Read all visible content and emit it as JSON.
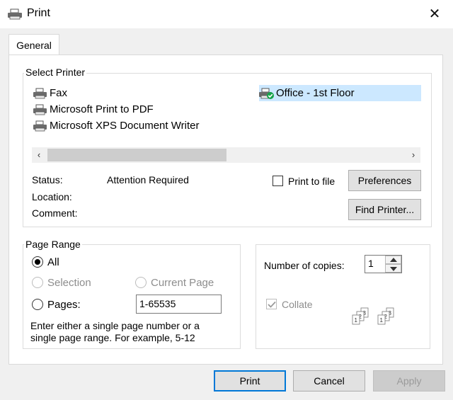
{
  "window": {
    "title": "Print",
    "close_glyph": "✕"
  },
  "tabs": [
    {
      "label": "General"
    }
  ],
  "select_printer": {
    "title": "Select Printer",
    "printers": [
      {
        "name": "Fax"
      },
      {
        "name": "Microsoft Print to PDF"
      },
      {
        "name": "Microsoft XPS Document Writer"
      },
      {
        "name": "Office - 1st Floor",
        "selected": true,
        "default": true
      }
    ],
    "scroll_left": "‹",
    "scroll_right": "›",
    "status_label": "Status:",
    "status_value": "Attention Required",
    "location_label": "Location:",
    "location_value": "",
    "comment_label": "Comment:",
    "comment_value": "",
    "print_to_file_label": "Print to file",
    "print_to_file_checked": false,
    "preferences_label": "Preferences",
    "find_printer_label": "Find Printer..."
  },
  "page_range": {
    "title": "Page Range",
    "all_label": "All",
    "selection_label": "Selection",
    "current_page_label": "Current Page",
    "pages_label": "Pages:",
    "pages_value": "1-65535",
    "selected_option": "All",
    "help_line1": "Enter either a single page number or a",
    "help_line2": "single page range.  For example, 5-12"
  },
  "copies": {
    "label": "Number of copies:",
    "value": "1",
    "collate_label": "Collate",
    "collate_checked": true,
    "collate_enabled": false
  },
  "footer": {
    "print_label": "Print",
    "cancel_label": "Cancel",
    "apply_label": "Apply"
  },
  "colors": {
    "dialog_bg": "#f0f0f0",
    "selection": "#cce8ff",
    "accent": "#0078d7",
    "default_check": "#16a34a"
  }
}
